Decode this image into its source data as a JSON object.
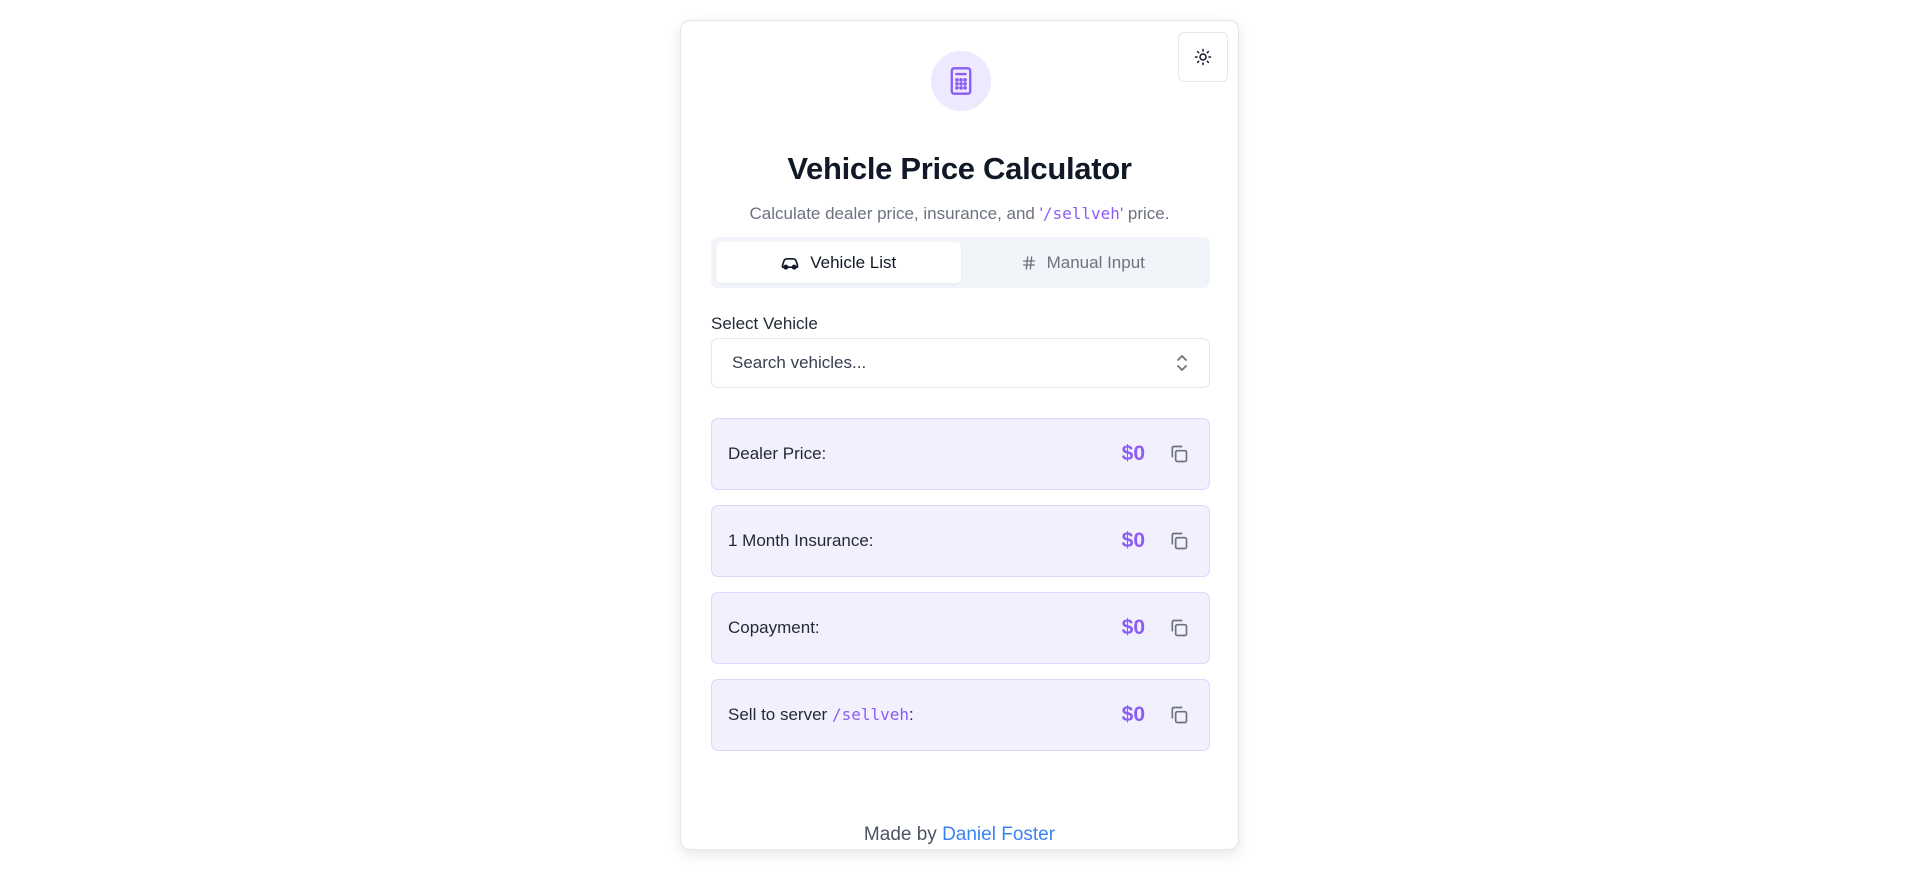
{
  "header": {
    "title": "Vehicle Price Calculator",
    "subtitle_prefix": "Calculate dealer price, insurance, and '",
    "subtitle_code": "/sellveh",
    "subtitle_suffix": "' price."
  },
  "icons": {
    "theme_toggle": "sun-icon",
    "logo": "calculator-icon",
    "tab_vehicle_list": "car-icon",
    "tab_manual_input": "hash-icon",
    "select_chevron": "chevrons-up-down-icon",
    "copy": "copy-icon"
  },
  "tabs": [
    {
      "label": "Vehicle List",
      "active": true
    },
    {
      "label": "Manual Input",
      "active": false
    }
  ],
  "vehicle_select": {
    "label": "Select Vehicle",
    "placeholder": "Search vehicles..."
  },
  "results": [
    {
      "label": "Dealer Price:",
      "amount": "$0"
    },
    {
      "label": "1 Month Insurance:",
      "amount": "$0"
    },
    {
      "label": "Copayment:",
      "amount": "$0"
    },
    {
      "label_prefix": "Sell to server ",
      "label_code": "/sellveh",
      "label_suffix": ":",
      "amount": "$0"
    }
  ],
  "footer": {
    "prefix": "Made by ",
    "author": "Daniel Foster"
  },
  "colors": {
    "accent": "#8b5cf6",
    "accent_bg": "#f3f0fe",
    "link": "#3b82f6"
  }
}
